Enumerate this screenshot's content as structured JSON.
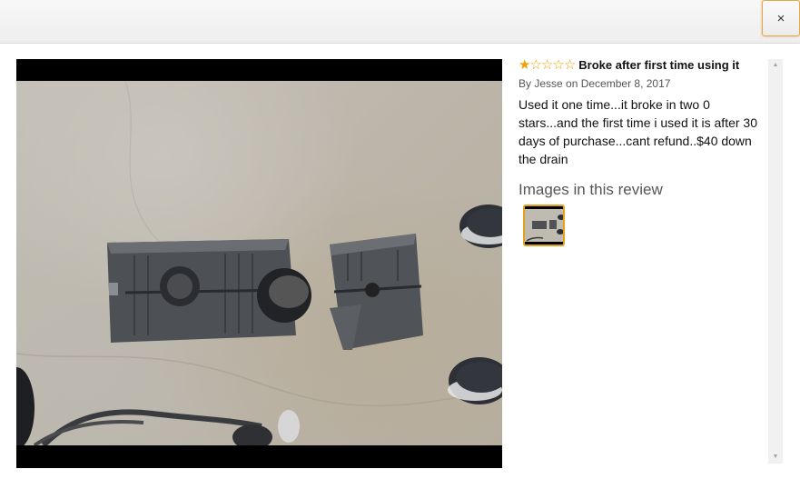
{
  "modal": {
    "close_label": "×"
  },
  "review": {
    "rating": 1,
    "rating_max": 5,
    "title": "Broke after first time using it",
    "byline_prefix": "By ",
    "author": "Jesse",
    "date_text": " on December 8, 2017",
    "body": "Used it one time...it broke in two 0 stars...and the first time i used it is after 30 days of purchase...cant refund..$40 down the drain",
    "images_heading": "Images in this review"
  },
  "icons": {
    "star_filled": "★",
    "star_empty": "☆",
    "scroll_up": "▲",
    "scroll_down": "▼"
  },
  "colors": {
    "star": "#f1a100",
    "thumb_border": "#e4a11b",
    "close_border": "#e3a84a"
  }
}
